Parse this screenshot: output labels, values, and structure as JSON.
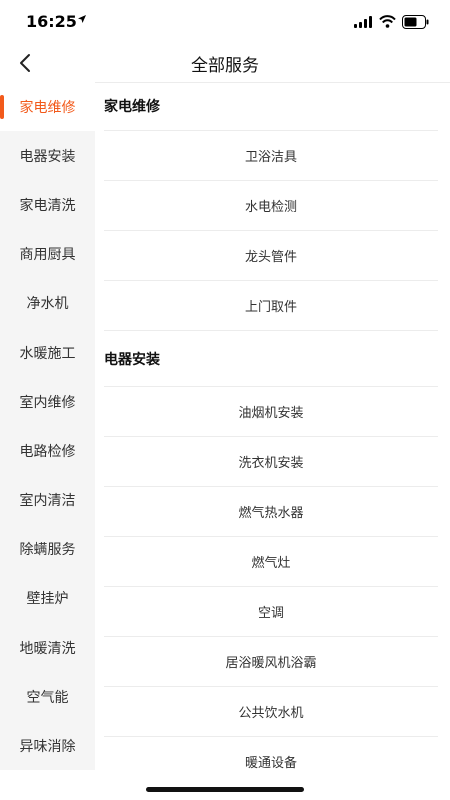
{
  "status": {
    "time": "16:25"
  },
  "nav": {
    "title": "全部服务"
  },
  "sidebar": {
    "items": [
      {
        "label": "家电维修",
        "active": true
      },
      {
        "label": "电器安装"
      },
      {
        "label": "家电清洗"
      },
      {
        "label": "商用厨具"
      },
      {
        "label": "净水机"
      },
      {
        "label": "水暖施工"
      },
      {
        "label": "室内维修"
      },
      {
        "label": "电路检修"
      },
      {
        "label": "室内清洁"
      },
      {
        "label": "除螨服务"
      },
      {
        "label": "壁挂炉"
      },
      {
        "label": "地暖清洗"
      },
      {
        "label": "空气能"
      },
      {
        "label": "异味消除"
      }
    ]
  },
  "sections": [
    {
      "title": "家电维修",
      "items": [
        "卫浴洁具",
        "水电检测",
        "龙头管件",
        "上门取件"
      ]
    },
    {
      "title": "电器安装",
      "items": [
        "油烟机安装",
        "洗衣机安装",
        "燃气热水器",
        "燃气灶",
        "空调",
        "居浴暖风机浴霸",
        "公共饮水机",
        "暖通设备"
      ]
    }
  ],
  "colors": {
    "accent": "#f25a1b",
    "sidebar_bg": "#f5f5f5"
  },
  "icons": [
    "location-arrow-icon",
    "signal-icon",
    "wifi-icon",
    "battery-icon",
    "back-icon"
  ]
}
